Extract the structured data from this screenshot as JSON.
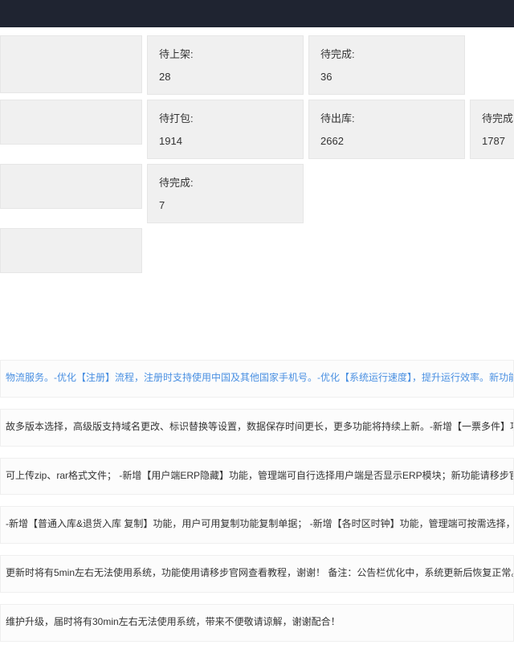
{
  "stats": {
    "row1": [
      {
        "label": "待上架:",
        "value": "28"
      },
      {
        "label": "待完成:",
        "value": "36"
      }
    ],
    "row2": [
      {
        "label": "待打包:",
        "value": "1914"
      },
      {
        "label": "待出库:",
        "value": "2662"
      },
      {
        "label": "待完成:",
        "value": "1787"
      }
    ],
    "row3": [
      {
        "label": "待完成:",
        "value": "7"
      }
    ]
  },
  "notices": {
    "n1": "物流服务。-优化【注册】流程，注册时支持使用中国及其他国家手机号。-优化【系统运行速度】，提升运行效率。新功能使用请移步官网查看教程，谢谢！",
    "n2": "故多版本选择，高级版支持域名更改、标识替换等设置，数据保存时间更长，更多功能将持续上新。-新增【一票多件】功能，一票多件订单提交时将验证物流服务是否支持。新",
    "n3": "可上传zip、rar格式文件； -新增【用户端ERP隐藏】功能，管理端可自行选择用户端是否显示ERP模块；新功能请移步官网查看使用教程，谢谢！",
    "n4": "-新增【普通入库&退货入库 复制】功能，用户可用复制功能复制单据； -新增【各时区时钟】功能，管理端可按需选择，时钟将在管理端及用户端首页显示； -优化退货入库列表",
    "n5": "更新时将有5min左右无法使用系统，功能使用请移步官网查看教程，谢谢！ 备注：公告栏优化中，系统更新后恢复正常。",
    "n6": "维护升级，届时将有30min左右无法使用系统，带来不便敬请谅解，谢谢配合！"
  }
}
